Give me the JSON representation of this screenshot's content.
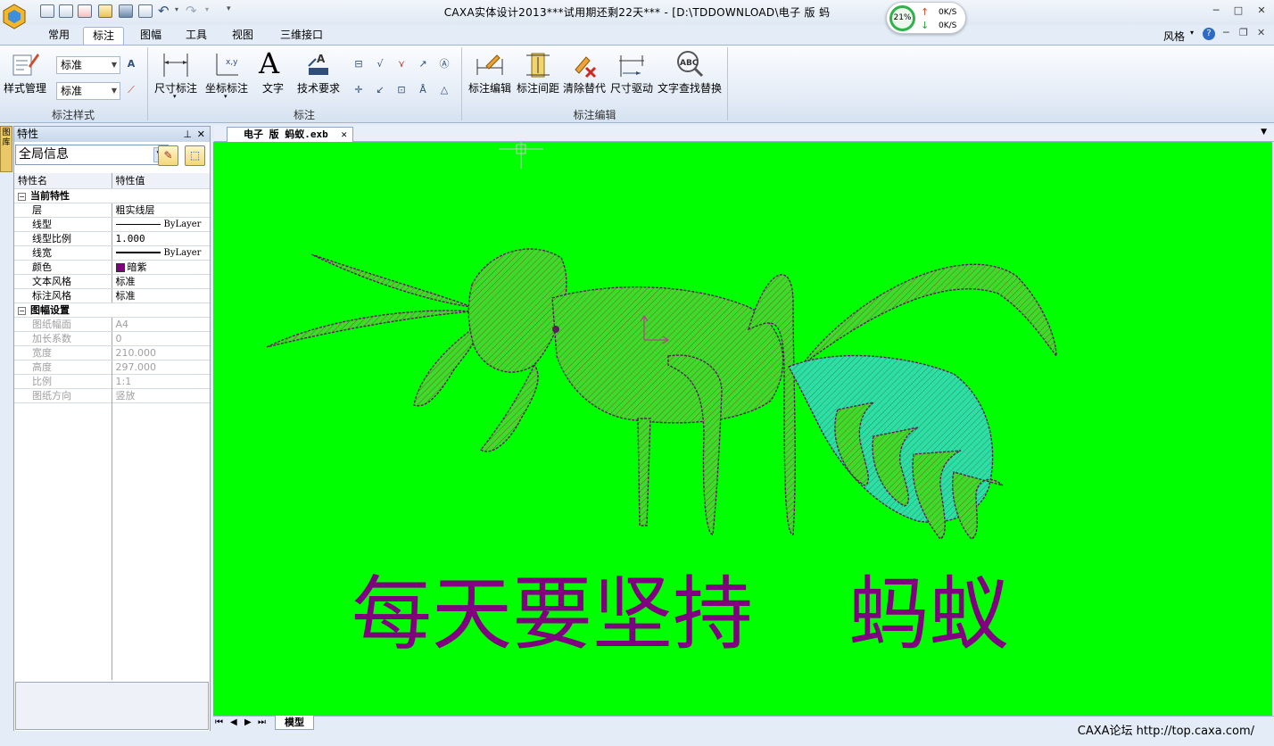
{
  "window": {
    "title": "CAXA实体设计2013***试用期还剩22天*** - [D:\\TDDOWNLOAD\\电子 版 蚂"
  },
  "net_meter": {
    "cpu": "21%",
    "up": "0K/S",
    "down": "0K/S"
  },
  "menu_tabs": [
    {
      "label": "常用",
      "active": false
    },
    {
      "label": "标注",
      "active": true
    },
    {
      "label": "图幅",
      "active": false
    },
    {
      "label": "工具",
      "active": false
    },
    {
      "label": "视图",
      "active": false
    },
    {
      "label": "三维接口",
      "active": false
    }
  ],
  "style_menu": "风格",
  "ribbon": {
    "style_group": {
      "label": "标注样式",
      "style_manager": "样式管理",
      "text_style_value": "标准",
      "dim_style_value": "标准"
    },
    "annot_group": {
      "label": "标注",
      "dimension": "尺寸标注",
      "coordinate": "坐标标注",
      "text": "文字",
      "tech_req": "技术要求"
    },
    "edit_group": {
      "label": "标注编辑",
      "edit": "标注编辑",
      "spacing": "标注间距",
      "clear_override": "清除替代",
      "dim_drive": "尺寸驱动",
      "find_replace": "文字查找替换"
    }
  },
  "properties_panel": {
    "title": "特性",
    "selector": "全局信息",
    "header": {
      "name": "特性名",
      "value": "特性值"
    },
    "sections": [
      {
        "title": "当前特性",
        "rows": [
          {
            "name": "层",
            "value": "粗实线层",
            "disabled": false
          },
          {
            "name": "线型",
            "value": "ByLayer",
            "disabled": false,
            "swatch": "line-thin"
          },
          {
            "name": "线型比例",
            "value": "1.000",
            "disabled": false
          },
          {
            "name": "线宽",
            "value": "ByLayer",
            "disabled": false,
            "swatch": "line-thick"
          },
          {
            "name": "颜色",
            "value": "暗紫",
            "disabled": false,
            "swatch": "#800080"
          },
          {
            "name": "文本风格",
            "value": "标准",
            "disabled": false
          },
          {
            "name": "标注风格",
            "value": "标准",
            "disabled": false
          }
        ]
      },
      {
        "title": "图幅设置",
        "rows": [
          {
            "name": "图纸幅面",
            "value": "A4",
            "disabled": true
          },
          {
            "name": "加长系数",
            "value": "0",
            "disabled": true
          },
          {
            "name": "宽度",
            "value": "210.000",
            "disabled": true
          },
          {
            "name": "高度",
            "value": "297.000",
            "disabled": true
          },
          {
            "name": "比例",
            "value": "1:1",
            "disabled": true
          },
          {
            "name": "图纸方向",
            "value": "竖放",
            "disabled": true
          }
        ]
      }
    ]
  },
  "side_tab": "图库",
  "document_tab": "电子 版 蚂蚁.exb",
  "canvas": {
    "background": "#00ff00",
    "drawing_color": "#800080",
    "caption_left": "每天要坚持",
    "caption_right": "蚂蚁"
  },
  "model_tab": "模型",
  "footer_link": "CAXA论坛 http://top.caxa.com/"
}
